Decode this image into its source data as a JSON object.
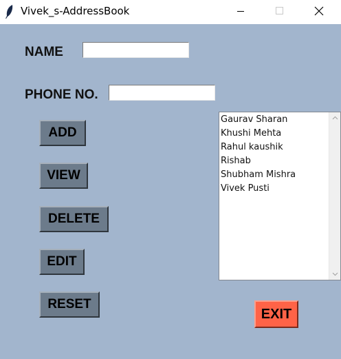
{
  "window": {
    "title": "Vivek_s-AddressBook",
    "icons": {
      "app": "feather-icon",
      "minimize": "minimize-icon",
      "maximize": "maximize-icon",
      "close": "close-icon"
    }
  },
  "form": {
    "name_label": "NAME",
    "name_value": "",
    "phone_label": "PHONE NO.",
    "phone_value": ""
  },
  "buttons": {
    "add": "ADD",
    "view": "VIEW",
    "delete": "DELETE",
    "edit": "EDIT",
    "reset": "RESET",
    "exit": "EXIT"
  },
  "contacts": [
    "Gaurav Sharan",
    "Khushi Mehta",
    "Rahul kaushik",
    "Rishab",
    "Shubham Mishra",
    "Vivek Pusti"
  ],
  "colors": {
    "background": "#a2b5cd",
    "button": "#6c7b8b",
    "exit_button": "#ff6347"
  }
}
